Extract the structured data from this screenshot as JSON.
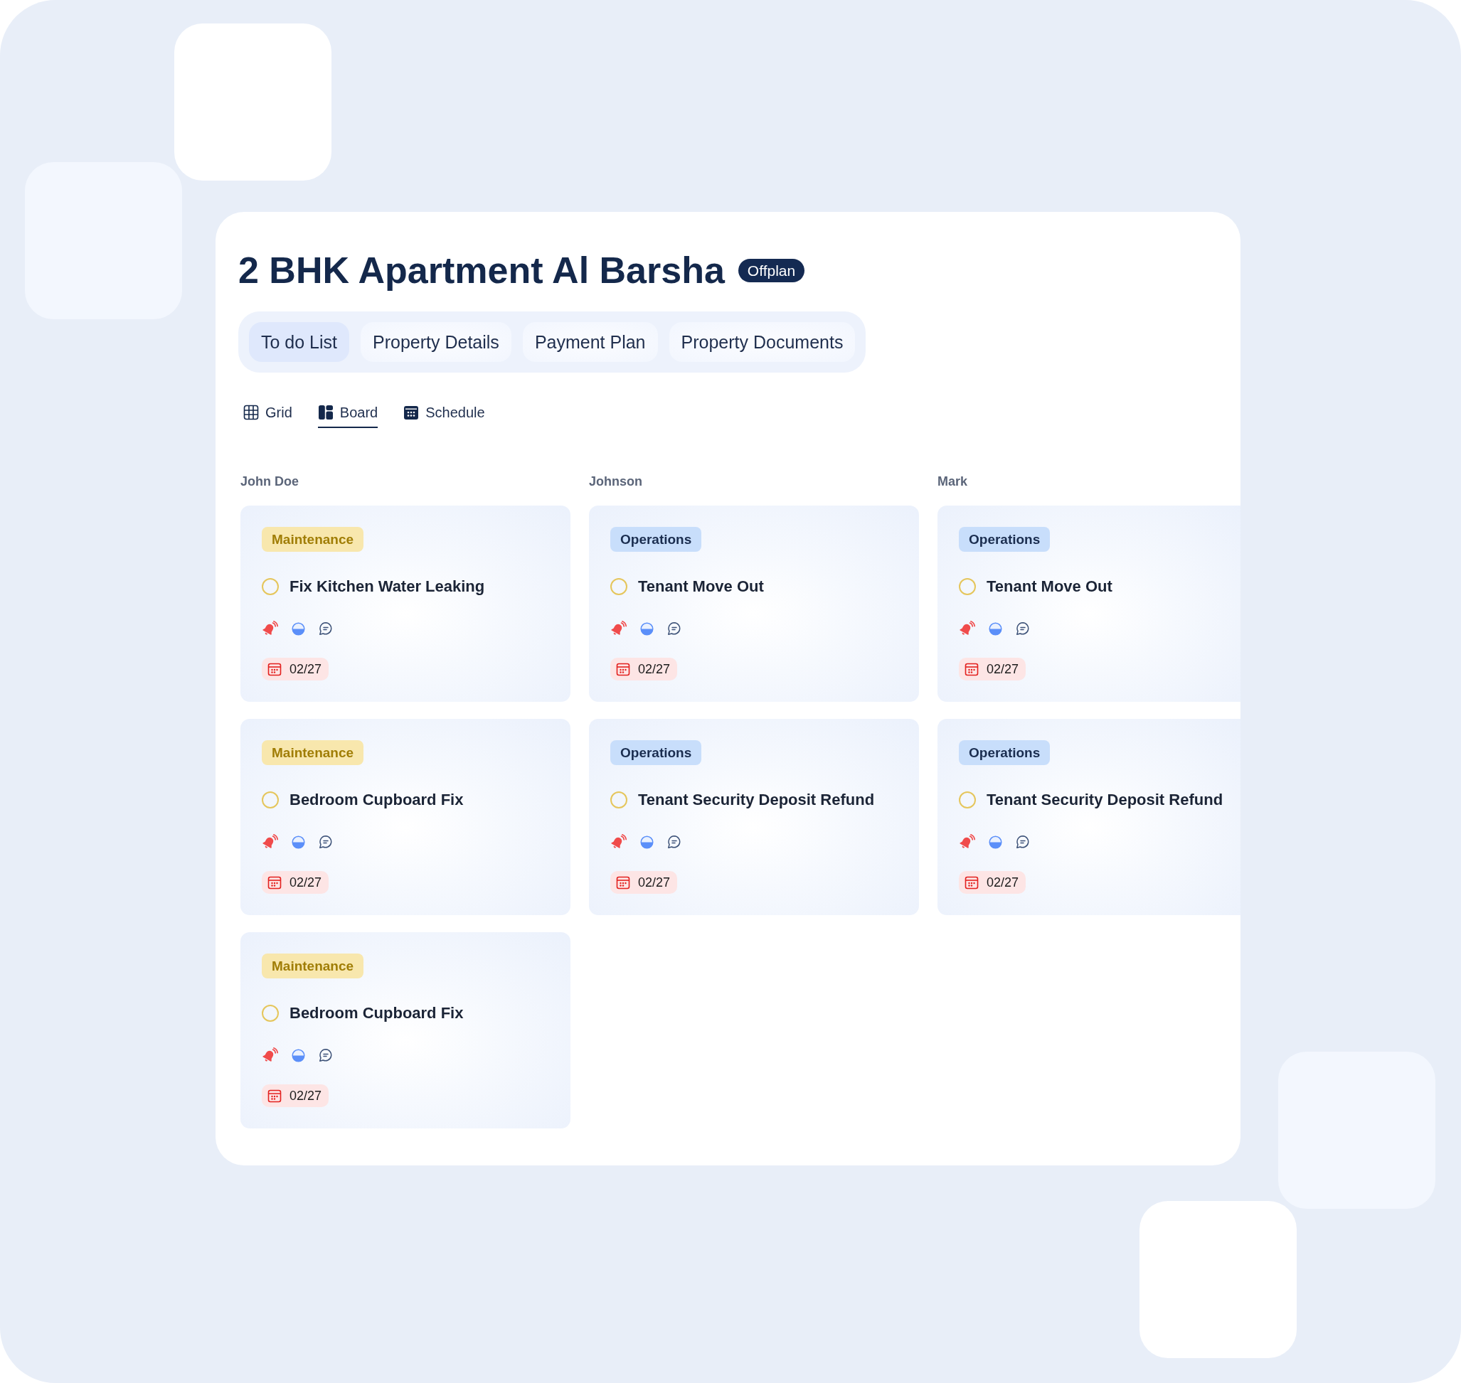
{
  "header": {
    "title": "2 BHK Apartment Al Barsha",
    "badge": "Offplan"
  },
  "tabs": [
    {
      "label": "To do List",
      "selected": true
    },
    {
      "label": "Property Details",
      "selected": false
    },
    {
      "label": "Payment Plan",
      "selected": false
    },
    {
      "label": "Property Documents",
      "selected": false
    }
  ],
  "views": [
    {
      "label": "Grid",
      "kind": "grid",
      "selected": false
    },
    {
      "label": "Board",
      "kind": "board",
      "selected": true
    },
    {
      "label": "Schedule",
      "kind": "schedule",
      "selected": false
    }
  ],
  "columns": [
    {
      "name": "John Doe",
      "cards": [
        {
          "tag": {
            "label": "Maintenance",
            "kind": "maintenance"
          },
          "title": "Fix Kitchen Water Leaking",
          "done": false,
          "date": "02/27"
        },
        {
          "tag": {
            "label": "Maintenance",
            "kind": "maintenance"
          },
          "title": "Bedroom Cupboard Fix",
          "done": false,
          "date": "02/27"
        },
        {
          "tag": {
            "label": "Maintenance",
            "kind": "maintenance"
          },
          "title": "Bedroom Cupboard Fix",
          "done": false,
          "date": "02/27"
        }
      ]
    },
    {
      "name": "Johnson",
      "cards": [
        {
          "tag": {
            "label": "Operations",
            "kind": "operations"
          },
          "title": "Tenant Move Out",
          "done": false,
          "date": "02/27"
        },
        {
          "tag": {
            "label": "Operations",
            "kind": "operations"
          },
          "title": "Tenant Security Deposit Refund",
          "done": false,
          "date": "02/27"
        }
      ]
    },
    {
      "name": "Mark",
      "cards": [
        {
          "tag": {
            "label": "Operations",
            "kind": "operations"
          },
          "title": "Tenant Move Out",
          "done": false,
          "date": "02/27"
        },
        {
          "tag": {
            "label": "Operations",
            "kind": "operations"
          },
          "title": "Tenant Security Deposit Refund",
          "done": false,
          "date": "02/27"
        }
      ]
    }
  ]
}
